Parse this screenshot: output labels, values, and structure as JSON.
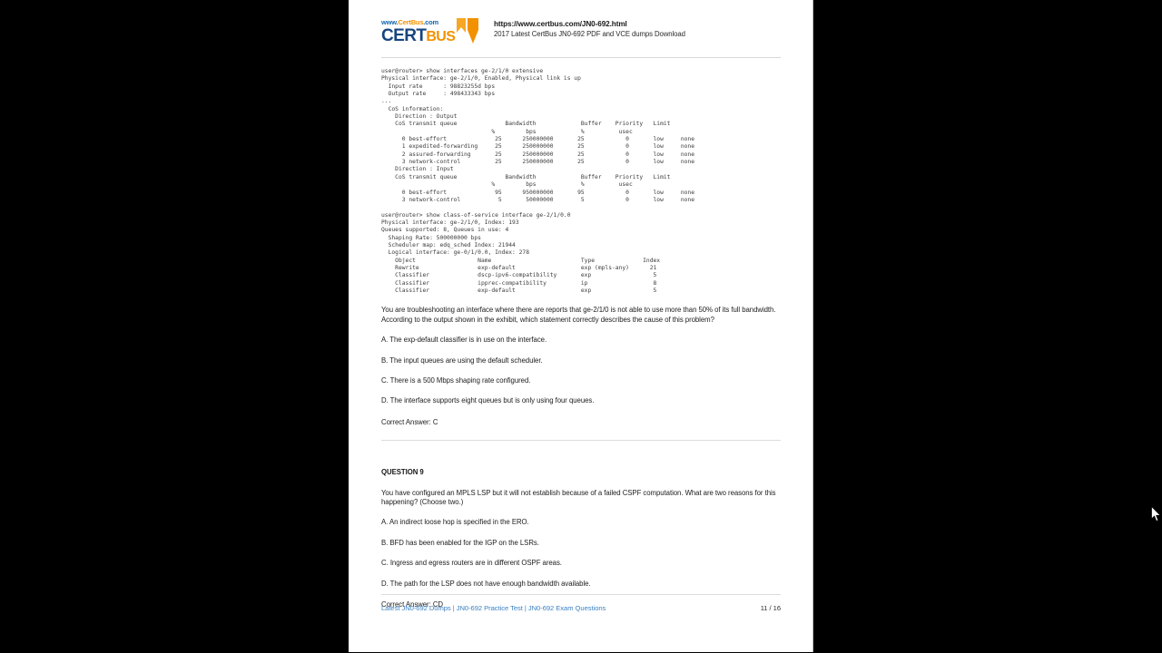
{
  "header": {
    "logo_top_blue_1": "www.",
    "logo_top_orange": "CertBus",
    "logo_top_blue_2": ".com",
    "logo_cert": "CERT",
    "logo_bus": "BUS",
    "url": "https://www.certbus.com/JN0-692.html",
    "subtitle": "2017 Latest CertBus JN0-692 PDF and VCE dumps Download",
    "brand_blue": "#17457e",
    "brand_orange": "#f29200"
  },
  "exhibit": {
    "text": "user@router> show interfaces ge-2/1/0 extensive\nPhysical interface: ge-2/1/0, Enabled, Physical link is up\n  Input rate      : 98823255d bps\n  Output rate     : 498433343 bps\n...\n  CoS information:\n    Direction : Output\n    CoS transmit queue              Bandwidth             Buffer    Priority   Limit\n                                %         bps             %          usec\n      0 best-effort              25      250000000       25            0       low     none\n      1 expedited-forwarding     25      250000000       25            0       low     none\n      2 assured-forwarding       25      250000000       25            0       low     none\n      3 network-control          25      250000000       25            0       low     none\n    Direction : Input\n    CoS transmit queue              Bandwidth             Buffer    Priority   Limit\n                                %         bps             %          usec\n      0 best-effort              95      950000000       95            0       low     none\n      3 network-control           5       50000000        5            0       low     none\n\nuser@router> show class-of-service interface ge-2/1/0.0\nPhysical interface: ge-2/1/0, Index: 193\nQueues supported: 8, Queues in use: 4\n  Shaping Rate: 500000000 bps\n  Scheduler map: edq_sched Index: 21944\n  Logical interface: ge-0/1/0.0, Index: 278\n    Object                  Name                          Type              Index\n    Rewrite                 exp-default                   exp (mpls-any)      21\n    Classifier              dscp-ipv6-compatibility       exp                  5\n    Classifier              ipprec-compatibility          ip                   8\n    Classifier              exp-default                   exp                  5"
  },
  "question8": {
    "stem": "You are troubleshooting an interface where there are reports that ge-2/1/0 is not able to use more than 50% of its full bandwidth. According to the output shown in the exhibit, which statement correctly describes the cause of this problem?",
    "choices": [
      "A. The exp-default classifier is in use on the interface.",
      "B. The input queues are using the default scheduler.",
      "C. There is a 500 Mbps shaping rate configured.",
      "D. The interface supports eight queues but is only using four queues."
    ],
    "answer": "Correct Answer: C"
  },
  "question9": {
    "heading": "QUESTION 9",
    "stem": "You have configured an MPLS LSP but it will not establish because of a failed CSPF computation. What are two reasons for this happening? (Choose two.)",
    "choices": [
      "A. An indirect loose hop is specified in the ERO.",
      "B. BFD has been enabled for the IGP on the LSRs.",
      "C. Ingress and egress routers are in different OSPF areas.",
      "D. The path for the LSP does not have enough bandwidth available."
    ],
    "answer": "Correct Answer: CD"
  },
  "footer": {
    "link1": "Latest JN0-692 Dumps",
    "divider1": " | ",
    "link2": "JN0-692 Practice Test",
    "divider2": " | ",
    "link3": "JN0-692 Exam Questions",
    "page_number": "11 / 16",
    "link_color": "#3b82c4"
  }
}
